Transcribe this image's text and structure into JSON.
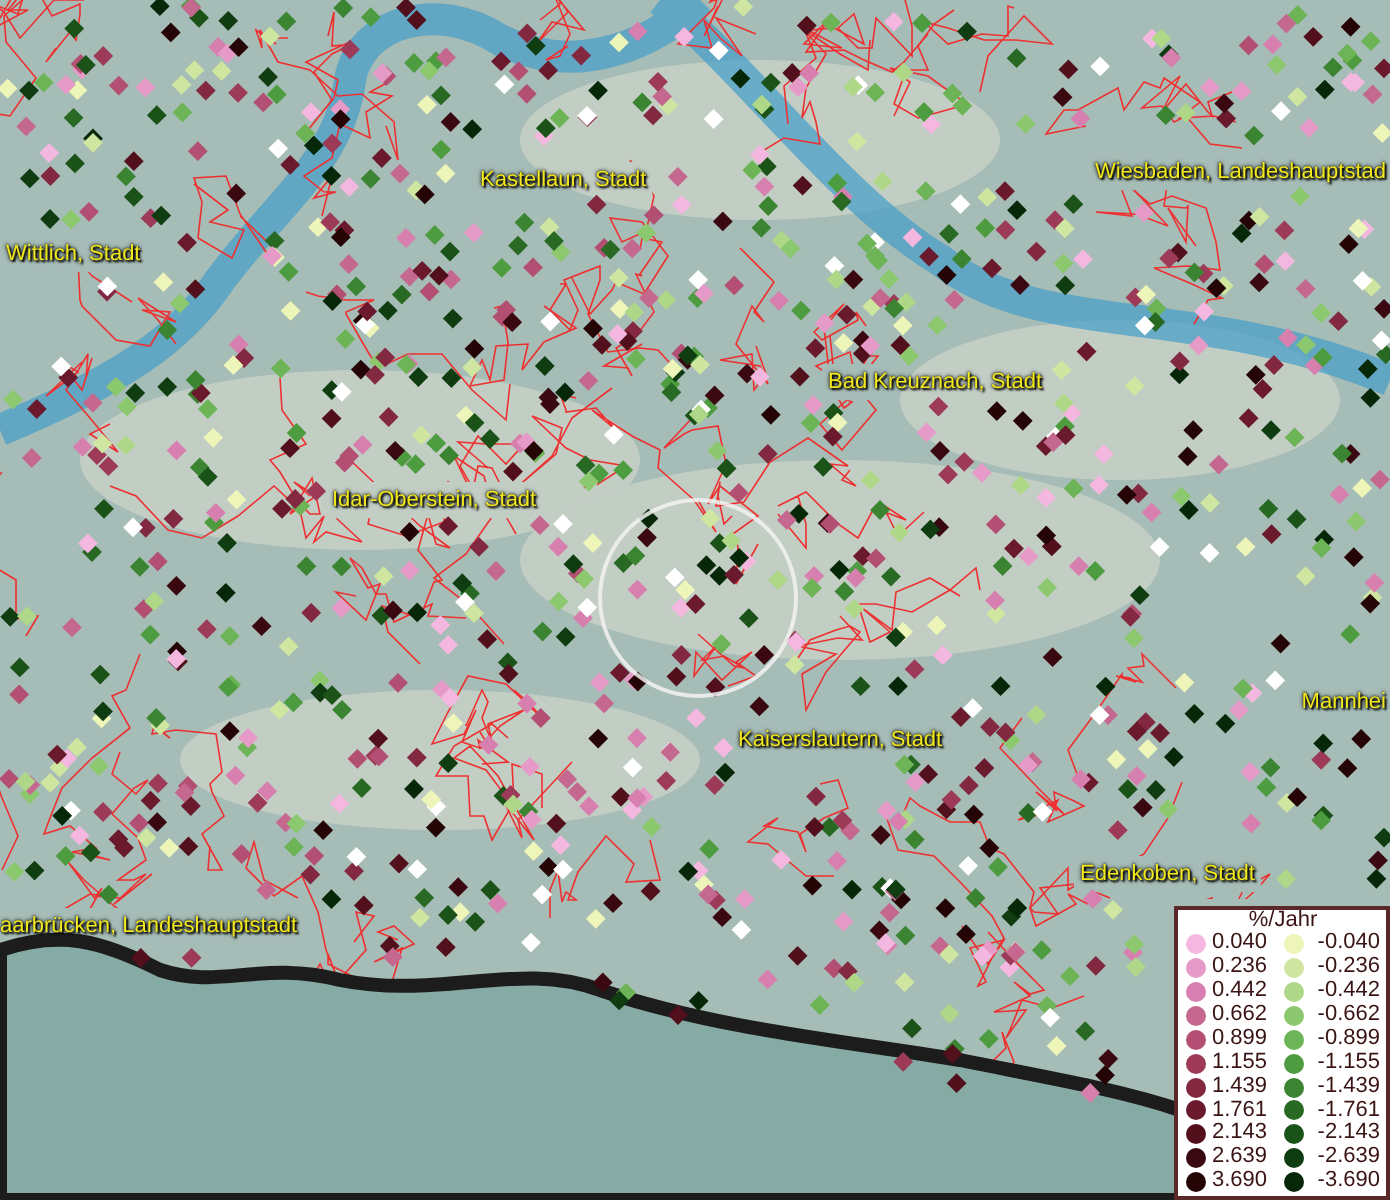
{
  "map": {
    "places": [
      {
        "label": "Kastellaun, Stadt"
      },
      {
        "label": "Wiesbaden, Landeshauptstad"
      },
      {
        "label": "Wittlich, Stadt"
      },
      {
        "label": "Bad Kreuznach, Stadt"
      },
      {
        "label": "Idar-Oberstein, Stadt"
      },
      {
        "label": "Mannhei"
      },
      {
        "label": "Kaiserslautern, Stadt"
      },
      {
        "label": "Edenkoben, Stadt"
      },
      {
        "label": "aarbrücken, Landeshauptstadt"
      }
    ]
  },
  "legend": {
    "title": "%/Jahr",
    "left": [
      {
        "label": "0.040",
        "color": "#f4b8e0"
      },
      {
        "label": "0.236",
        "color": "#e69ac8"
      },
      {
        "label": "0.442",
        "color": "#d77fae"
      },
      {
        "label": "0.662",
        "color": "#c56890"
      },
      {
        "label": "0.899",
        "color": "#b24f72"
      },
      {
        "label": "1.155",
        "color": "#9c3a58"
      },
      {
        "label": "1.439",
        "color": "#822840"
      },
      {
        "label": "1.761",
        "color": "#6a1a2c"
      },
      {
        "label": "2.143",
        "color": "#52101c"
      },
      {
        "label": "2.639",
        "color": "#3a0810"
      },
      {
        "label": "3.690",
        "color": "#250406"
      }
    ],
    "right": [
      {
        "label": "-0.040",
        "color": "#eef5b8"
      },
      {
        "label": "-0.236",
        "color": "#cfe6a0"
      },
      {
        "label": "-0.442",
        "color": "#aed888"
      },
      {
        "label": "-0.662",
        "color": "#8cc86e"
      },
      {
        "label": "-0.899",
        "color": "#6cb456"
      },
      {
        "label": "-1.155",
        "color": "#4e9c40"
      },
      {
        "label": "-1.439",
        "color": "#3a8432"
      },
      {
        "label": "-1.761",
        "color": "#286a24"
      },
      {
        "label": "-2.143",
        "color": "#1a5218"
      },
      {
        "label": "-2.639",
        "color": "#0f3c10"
      },
      {
        "label": "-3.690",
        "color": "#062808"
      }
    ]
  }
}
